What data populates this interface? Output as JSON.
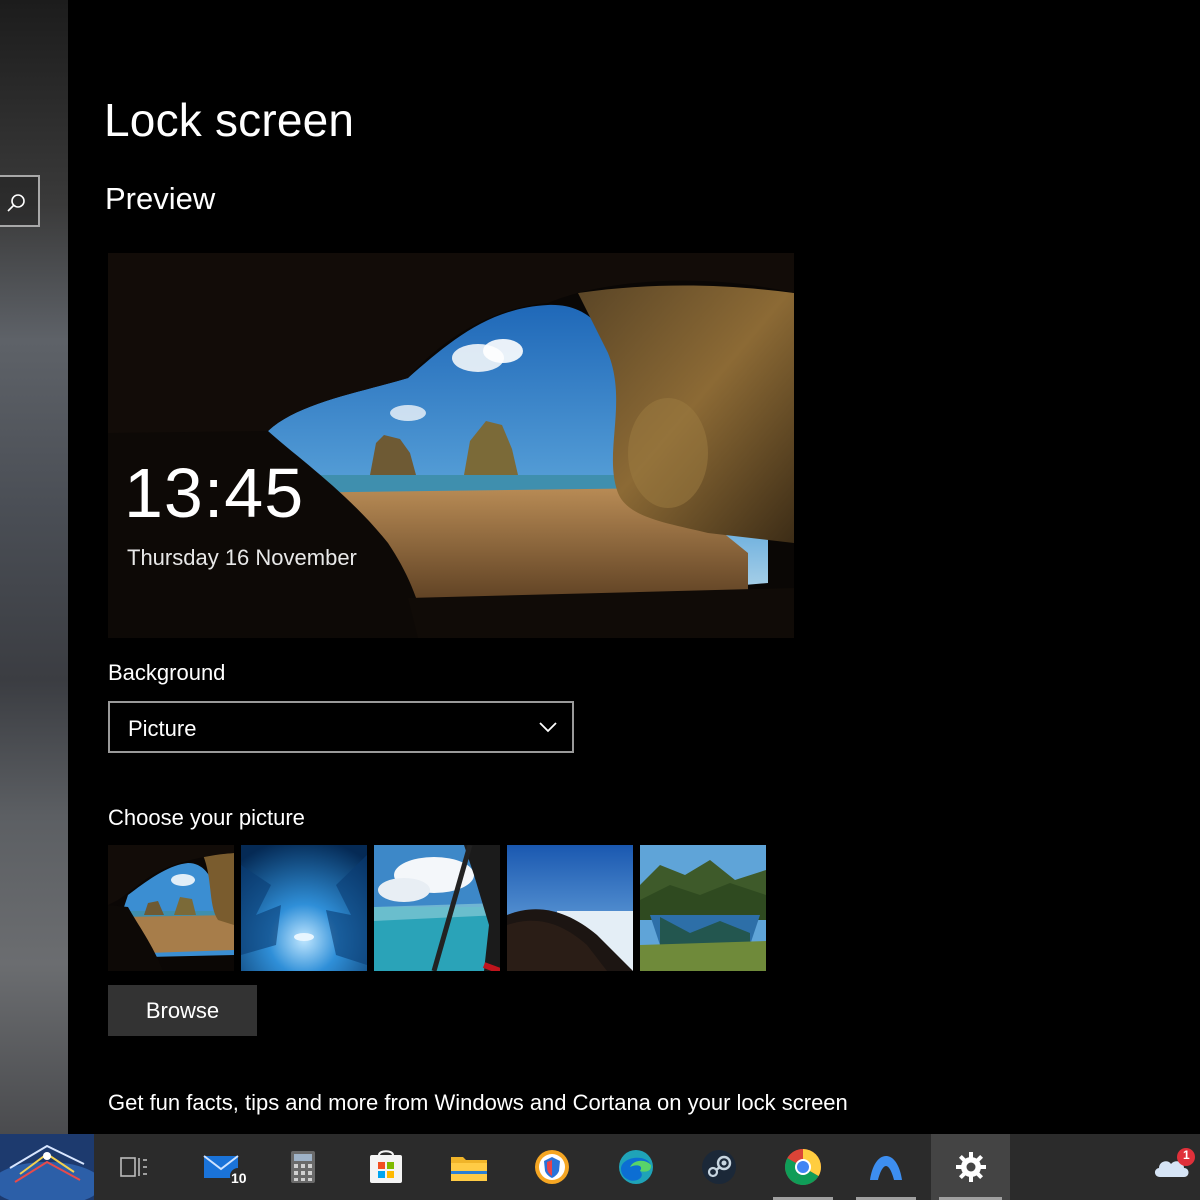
{
  "page": {
    "title": "Lock screen",
    "section": "Preview"
  },
  "preview": {
    "time": "13:45",
    "date": "Thursday 16 November"
  },
  "background": {
    "label": "Background",
    "selected": "Picture"
  },
  "choose_picture": {
    "label": "Choose your picture",
    "thumbnails": [
      "cave-beach",
      "ice-cave",
      "plane-window",
      "hill-sea",
      "mountain-lake"
    ]
  },
  "browse": {
    "label": "Browse"
  },
  "tips": {
    "text": "Get fun facts, tips and more from Windows and Cortana on your lock screen"
  },
  "taskbar": {
    "mail_badge": "10",
    "onedrive_badge": "1",
    "items": [
      "start-button",
      "task-view",
      "mail",
      "calculator",
      "microsoft-store",
      "file-explorer",
      "browser",
      "edge",
      "steam",
      "chrome",
      "vpn",
      "settings",
      "onedrive"
    ]
  },
  "colors": {
    "background": "#000000",
    "taskbar": "#2b2b2b",
    "button": "#333333",
    "select_border": "#9a9a9a"
  }
}
